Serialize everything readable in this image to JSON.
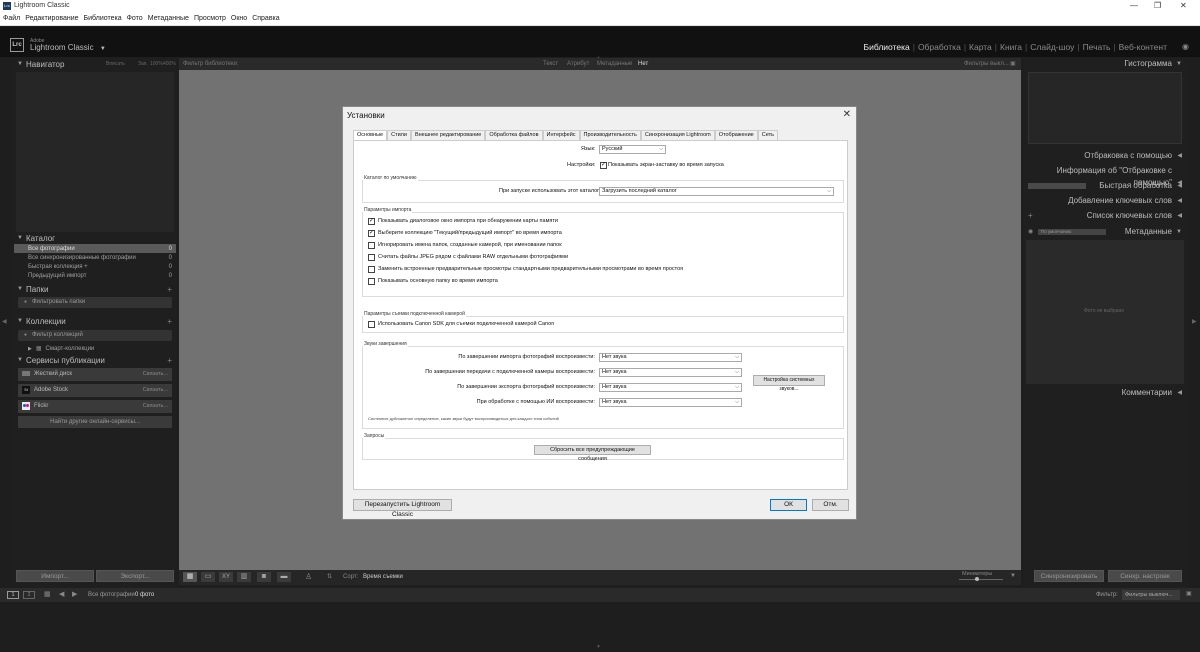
{
  "window": {
    "title": "Lightroom Classic"
  },
  "menu": [
    "Файл",
    "Редактирование",
    "Библиотека",
    "Фото",
    "Метаданные",
    "Просмотр",
    "Окно",
    "Справка"
  ],
  "brand": {
    "line1": "Adobe",
    "line2": "Lightroom Classic",
    "logo": "Lrc",
    "dropdown_arrow": "▼"
  },
  "modules": {
    "library": "Библиотека",
    "develop": "Обработка",
    "map": "Карта",
    "book": "Книга",
    "slideshow": "Слайд-шоу",
    "print": "Печать",
    "web": "Веб-контент"
  },
  "left": {
    "navigator": "Навигатор",
    "nav_opts": [
      "Вписать",
      "Зап.",
      "100%",
      "400%"
    ],
    "catalog": "Каталог",
    "catalog_items": [
      {
        "label": "Все фотографии",
        "count": "0"
      },
      {
        "label": "Все синхронизированные фотографии",
        "count": "0"
      },
      {
        "label": "Быстрая коллекция +",
        "count": "0"
      },
      {
        "label": "Предыдущий импорт",
        "count": "0"
      }
    ],
    "folders": "Папки",
    "folders_filter": "Фильтровать папки",
    "collections": "Коллекции",
    "collections_filter": "Фильтр коллекций",
    "smart_collections": "Смарт-коллекции",
    "publish": "Сервисы публикации",
    "publish_items": [
      "Жесткий диск",
      "Adobe Stock",
      "Flickr"
    ],
    "publish_setup": "Связать...",
    "find_more": "Найти другие онлайн-сервисы...",
    "import": "Импорт...",
    "export": "Экспорт..."
  },
  "filter": {
    "label": "Фильтр библиотеки:",
    "opts": [
      "Текст",
      "Атрибут",
      "Метаданные",
      "Нет"
    ],
    "right": "Фильтры выкл..."
  },
  "toolbar": {
    "sort_label": "Сорт:",
    "sort_value": "Время съемки",
    "thumbs": "Миниатюры"
  },
  "right": {
    "histogram": "Гистограмма",
    "panels": [
      "Отбраковка с помощью",
      "Информация об \"Отбраковке с помощью\"",
      "Быстрая обработка",
      "Добавление ключевых слов",
      "Список ключевых слов",
      "Метаданные"
    ],
    "preset": "По умолчанию",
    "comments": "Комментарии",
    "empty": "Фото не выбрано",
    "sync_meta": "Синхронизировать",
    "sync_settings": "Синхр. настроек"
  },
  "filmstrip": {
    "source": "Все фотографии",
    "count": "0 фото",
    "filter_label": "Фильтр:",
    "filter_value": "Фильтры выключ..."
  },
  "dialog": {
    "title": "Установки",
    "tabs": [
      "Основные",
      "Стили",
      "Внешнее редактирование",
      "Обработка файлов",
      "Интерфейс",
      "Производительность",
      "Синхронизация Lightroom",
      "Отображение",
      "Сеть"
    ],
    "language_label": "Язык:",
    "language_value": "Русский",
    "settings_label": "Настройки:",
    "splash": "Показывать экран-заставку во время запуска",
    "catalog_group": "Каталог по умолчанию",
    "catalog_label": "При запуске использовать этот каталог:",
    "catalog_value": "Загрузить последний каталог",
    "import_group": "Параметры импорта",
    "import_opts": [
      {
        "text": "Показывать диалоговое окно импорта при обнаружении карты памяти",
        "checked": true
      },
      {
        "text": "Выберите коллекцию \"Текущий/предыдущий импорт\" во время импорта",
        "checked": true
      },
      {
        "text": "Игнорировать имена папок, созданные камерой, при именовании папок",
        "checked": false
      },
      {
        "text": "Считать файлы JPEG рядом с файлами RAW отдельными фотографиями",
        "checked": false
      },
      {
        "text": "Заменить встроенные предварительные просмотры стандартными предварительными просмотрами во время простоя",
        "checked": false
      },
      {
        "text": "Показывать основную папку во время импорта",
        "checked": false
      }
    ],
    "tether_group": "Параметры съемки подключенной камерой",
    "tether_opt": "Использовать Canon SDK для съемки подключенной камерой Canon",
    "sounds_group": "Звуки завершения",
    "sounds": [
      {
        "label": "По завершении импорта фотографий воспроизвести:",
        "value": "Нет звука"
      },
      {
        "label": "По завершении передачи с подключенной камеры воспроизвести:",
        "value": "Нет звука"
      },
      {
        "label": "По завершении экспорта фотографий воспроизвести:",
        "value": "Нет звука"
      },
      {
        "label": "При обработке с помощью ИИ воспроизвести:",
        "value": "Нет звука"
      }
    ],
    "system_sounds_btn": "Настройка системных звуков...",
    "sounds_note": "Системное дубликатное определение, какие звуки будут воспроизводиться для каждого типа событий",
    "prompts_group": "Запросы",
    "reset_btn": "Сбросить все предупреждающие сообщения",
    "restart_btn": "Перезапустить Lightroom Classic",
    "ok": "ОК",
    "cancel": "Отм."
  }
}
